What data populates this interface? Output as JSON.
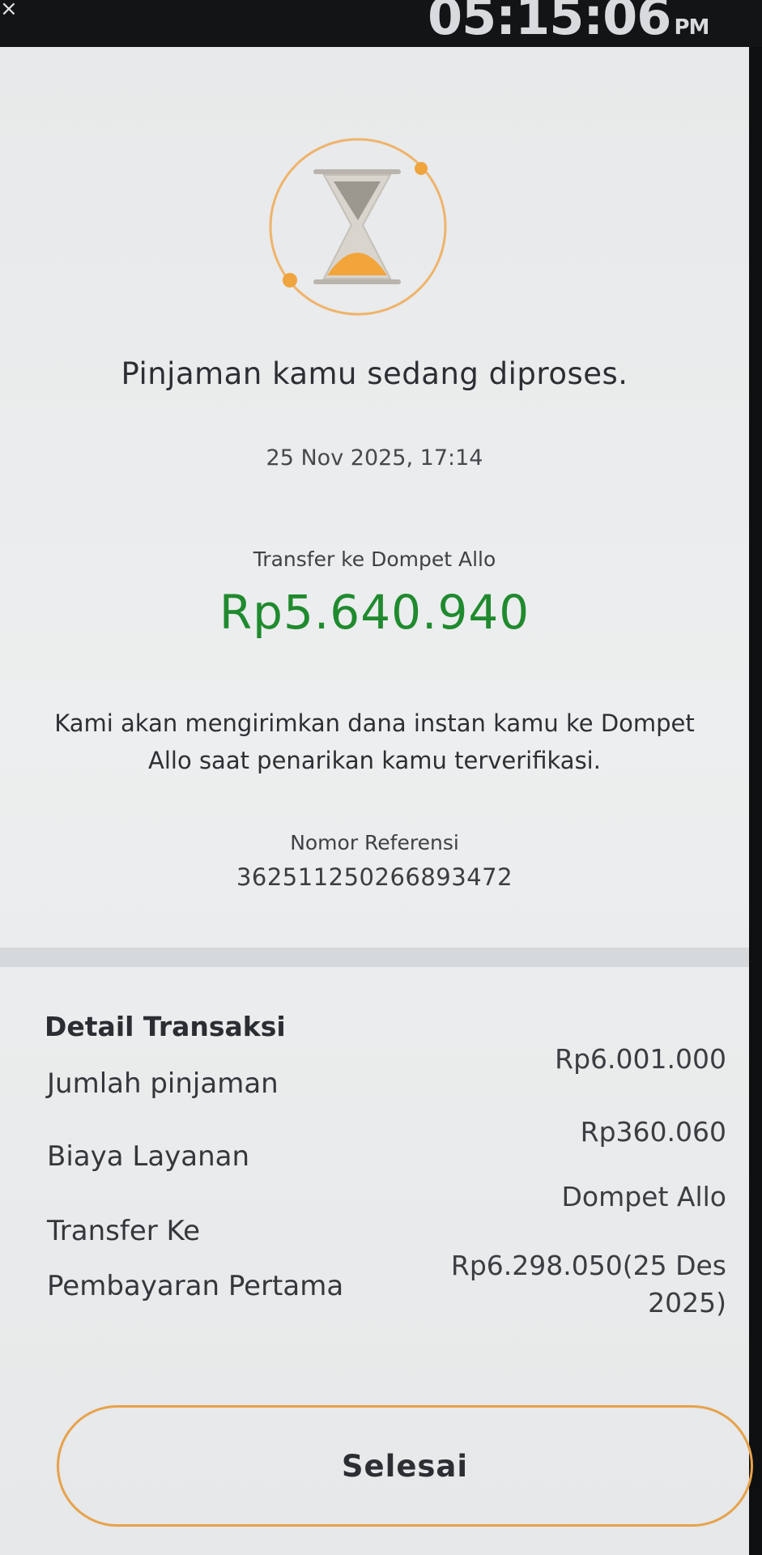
{
  "status_bar": {
    "close_glyph": "×",
    "time": "05:15:06",
    "ampm": "PM"
  },
  "status": {
    "icon": "hourglass-icon",
    "title": "Pinjaman kamu sedang diproses.",
    "datetime": "25 Nov 2025, 17:14"
  },
  "transfer": {
    "label": "Transfer ke Dompet Allo",
    "amount": "Rp5.640.940",
    "amount_color": "#1f8a2e"
  },
  "message": "Kami akan mengirimkan dana instan kamu ke Dompet Allo saat penarikan kamu terverifikasi.",
  "reference": {
    "label": "Nomor Referensi",
    "number": "362511250266893472"
  },
  "details": {
    "title": "Detail Transaksi",
    "rows": [
      {
        "label": "Jumlah pinjaman",
        "value": "Rp6.001.000"
      },
      {
        "label": "Biaya Layanan",
        "value": "Rp360.060"
      },
      {
        "label": "Transfer Ke",
        "value": "Dompet Allo"
      },
      {
        "label": "Pembayaran Pertama",
        "value": "Rp6.298.050(25 Des 2025)"
      }
    ]
  },
  "done_button": {
    "label": "Selesai",
    "border_color": "#e7a24a"
  }
}
